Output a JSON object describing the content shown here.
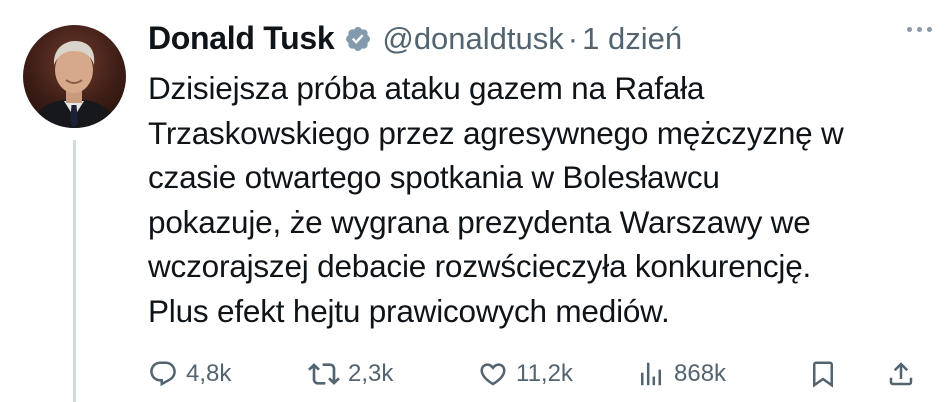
{
  "tweet": {
    "author_name": "Donald Tusk",
    "handle": "@donaldtusk",
    "separator": "·",
    "time": "1 dzień",
    "lines": [
      "Dzisiejsza próba ataku gazem na Rafała",
      "Trzaskowskiego przez agresywnego mężczyznę w",
      "czasie otwartego spotkania w Bolesławcu",
      "pokazuje, że wygrana prezydenta Warszawy we",
      "wczorajszej debacie rozwścieczyła konkurencję.",
      "Plus efekt hejtu prawicowych mediów."
    ]
  },
  "stats": {
    "replies": "4,8k",
    "retweets": "2,3k",
    "likes": "11,2k",
    "views": "868k"
  },
  "icons": {
    "verified": "verified-badge-icon",
    "more": "more-horizontal-icon",
    "reply": "reply-icon",
    "retweet": "retweet-icon",
    "like": "heart-icon",
    "views": "views-bar-chart-icon",
    "bookmark": "bookmark-icon",
    "share": "share-icon"
  },
  "colors": {
    "text": "#0f1419",
    "secondary": "#536471",
    "verified_badge": "#829aab",
    "thread_line": "#cfd9de"
  }
}
